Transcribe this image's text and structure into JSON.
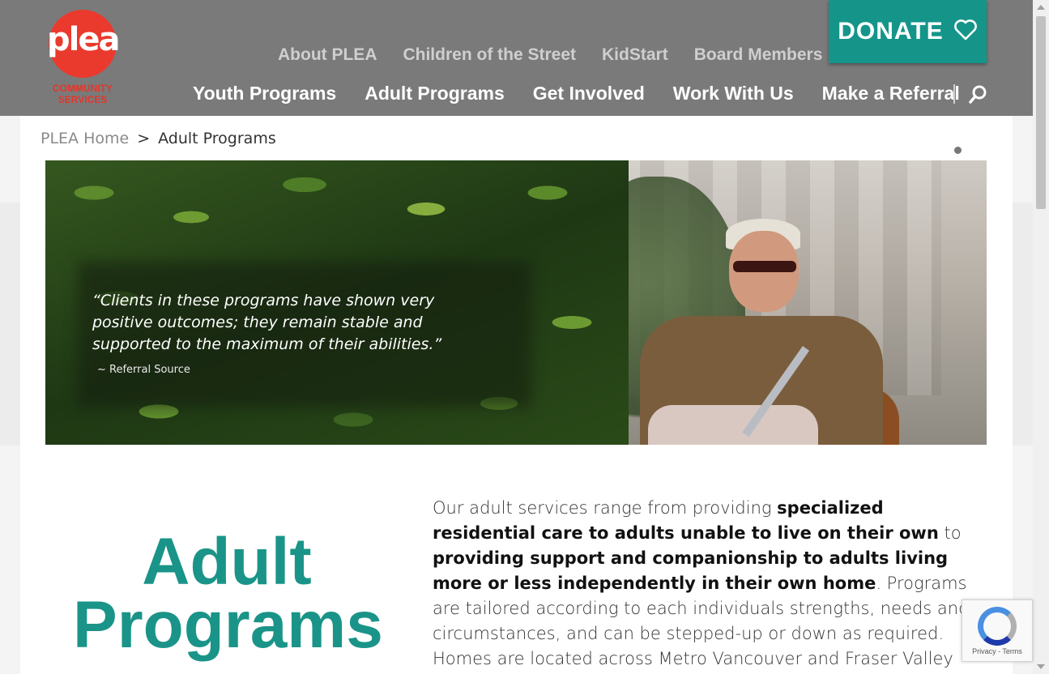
{
  "logo": {
    "word": "plea",
    "sub_line1": "COMMUNITY",
    "sub_line2": "SERVICES"
  },
  "topnav": [
    {
      "label": "About PLEA"
    },
    {
      "label": "Children of the Street"
    },
    {
      "label": "KidStart"
    },
    {
      "label": "Board Members"
    }
  ],
  "mainnav": [
    {
      "label": "Youth Programs"
    },
    {
      "label": "Adult Programs"
    },
    {
      "label": "Get Involved"
    },
    {
      "label": "Work With Us"
    },
    {
      "label": "Make a Referral"
    }
  ],
  "donate": {
    "label": "DONATE",
    "icon": "heart-icon"
  },
  "colors": {
    "header": "#7a7a7a",
    "accent": "#15958a",
    "logo_red": "#ea3a2e",
    "title_teal": "#1a9488"
  },
  "breadcrumb": {
    "home": "PLEA Home",
    "separator": ">",
    "current": "Adult Programs"
  },
  "hero": {
    "quote": "“Clients in these programs have shown very positive outcomes; they remain stable and supported to the maximum of their abilities.”",
    "source": "~ Referral Source"
  },
  "page_title": {
    "line1": "Adult",
    "line2": "Programs"
  },
  "intro": {
    "p1": "Our adult services range from providing ",
    "b1": "specialized residential care to adults unable to live on their own",
    "p2": " to ",
    "b2": "providing support and companionship to adults living more or less independently in their own home",
    "p3": ".  Programs are tailored according to each individuals strengths, needs and circumstances, and can be stepped-up or down as required. Homes are located across Metro Vancouver and Fraser Valley regions. They are all part of"
  },
  "recaptcha": {
    "terms": "Privacy - Terms"
  }
}
